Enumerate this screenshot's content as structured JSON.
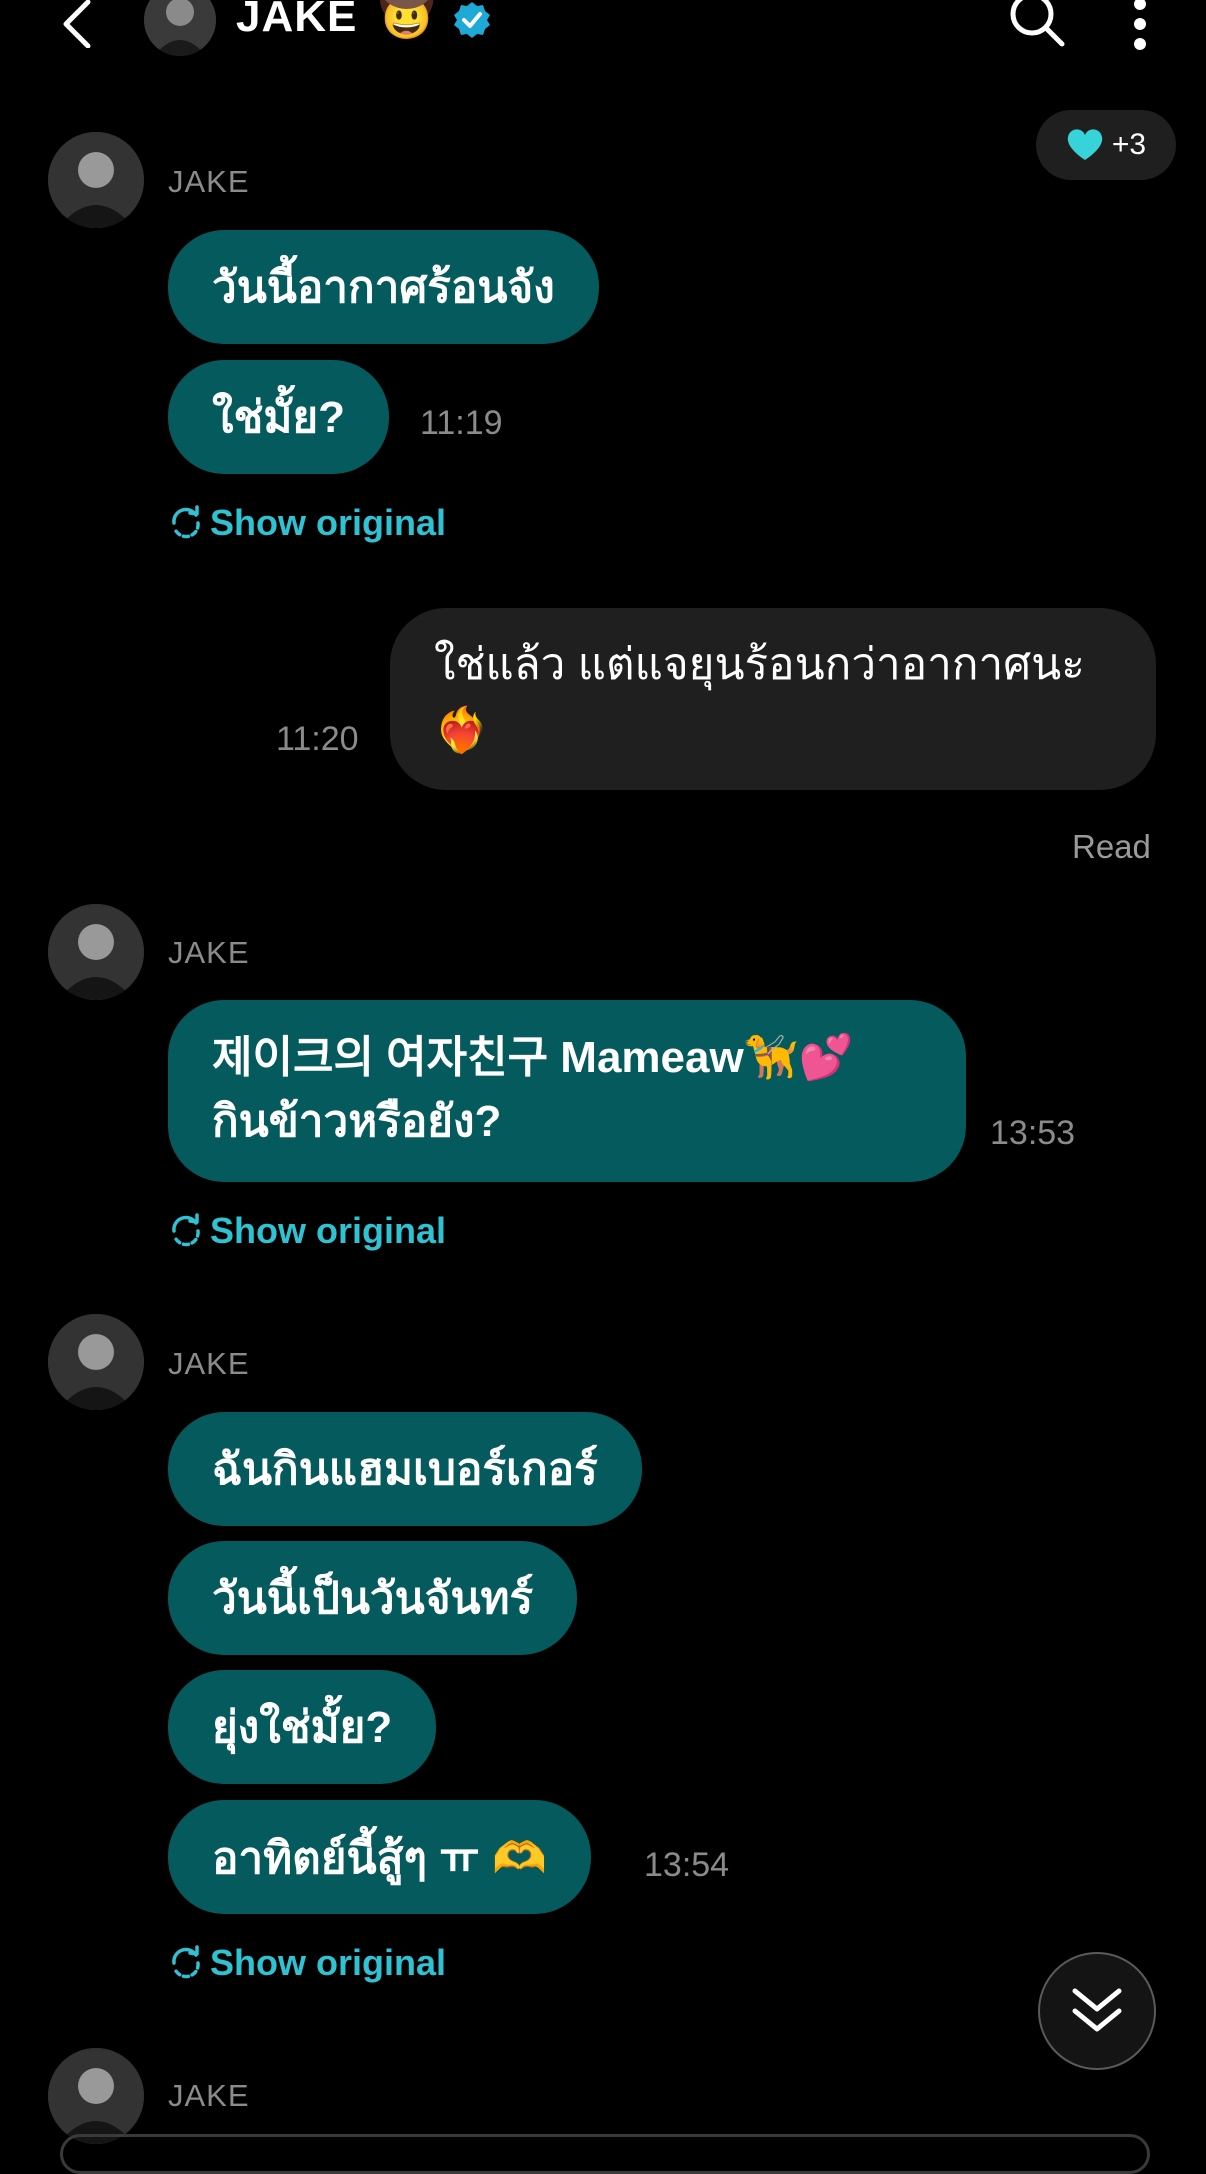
{
  "header": {
    "title": "JAKE",
    "emoji": "🤠"
  },
  "reaction": {
    "emoji": "🩵",
    "count": "+3"
  },
  "groups": [
    {
      "sender": "JAKE",
      "messages": [
        "วันนี้อากาศร้อนจัง",
        "ใช่มั้ย?"
      ],
      "time": "11:19",
      "show_original": "Show original"
    },
    {
      "outgoing": true,
      "message_line1": "ใช่แล้ว แต่แจยุนร้อนกว่าอากาศนะ",
      "message_line2": "❤️‍🔥",
      "time": "11:20",
      "status": "Read"
    },
    {
      "sender": "JAKE",
      "message_line1": "제이크의 여자친구 Mameaw🦮💕",
      "message_line2": "กินข้าวหรือยัง?",
      "time": "13:53",
      "show_original": "Show original"
    },
    {
      "sender": "JAKE",
      "messages": [
        "ฉันกินแฮมเบอร์เกอร์",
        "วันนี้เป็นวันจันทร์",
        "ยุ่งใช่มั้ย?",
        "อาทิตย์นี้สู้ๆ ㅠ 🫶"
      ],
      "time": "13:54",
      "show_original": "Show original"
    },
    {
      "sender": "JAKE"
    }
  ],
  "colors": {
    "background": "#000000",
    "incoming_bubble": "#045a5c",
    "outgoing_bubble": "#1f1f1f",
    "accent": "#2fc2d2",
    "muted_text": "#8b8b8b"
  },
  "icons": [
    "back-icon",
    "verified-icon",
    "search-icon",
    "more-icon",
    "translate-icon",
    "double-chevron-down-icon"
  ]
}
